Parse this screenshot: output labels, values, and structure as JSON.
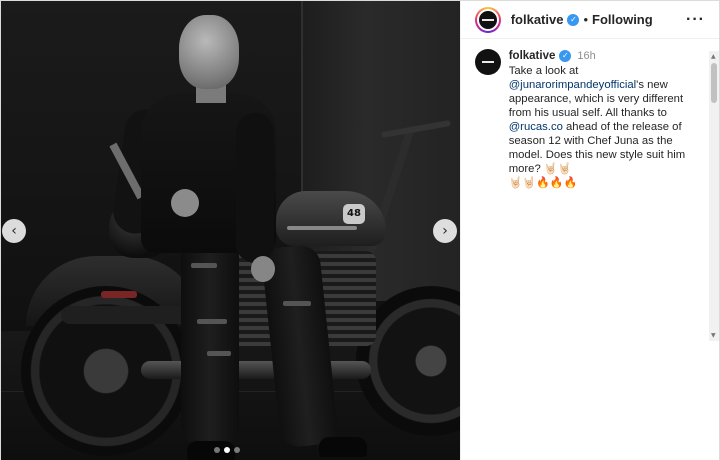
{
  "post": {
    "media": {
      "tank_badge": "48",
      "nav_prev": "‹",
      "nav_next": "›",
      "carousel": {
        "count": 3,
        "active_index": 1
      }
    },
    "header": {
      "username": "folkative",
      "verified_icon": "check-verified-icon",
      "separator": "•",
      "follow_status": "Following",
      "more_icon": "···"
    },
    "caption": {
      "username": "folkative",
      "time": "16h",
      "text_1": "Take a look at ",
      "mention_1": "@junarorimpandeyofficial",
      "text_2": "'s new appearance, which is very different from his usual self. All thanks to ",
      "mention_2": "@rucas.co",
      "text_3": " ahead of the release of season 12 with Chef Juna as the model. Does this new style suit him more? ",
      "emoji_1": "🤘🏻🤘🏻",
      "emoji_2": "🤘🏻🤘🏻🔥🔥🔥"
    },
    "scrollbar": {
      "up": "▲",
      "down": "▼"
    }
  },
  "colors": {
    "verified": "#3897f0",
    "mention": "#00376b",
    "timestamp": "#8e8e8e"
  }
}
